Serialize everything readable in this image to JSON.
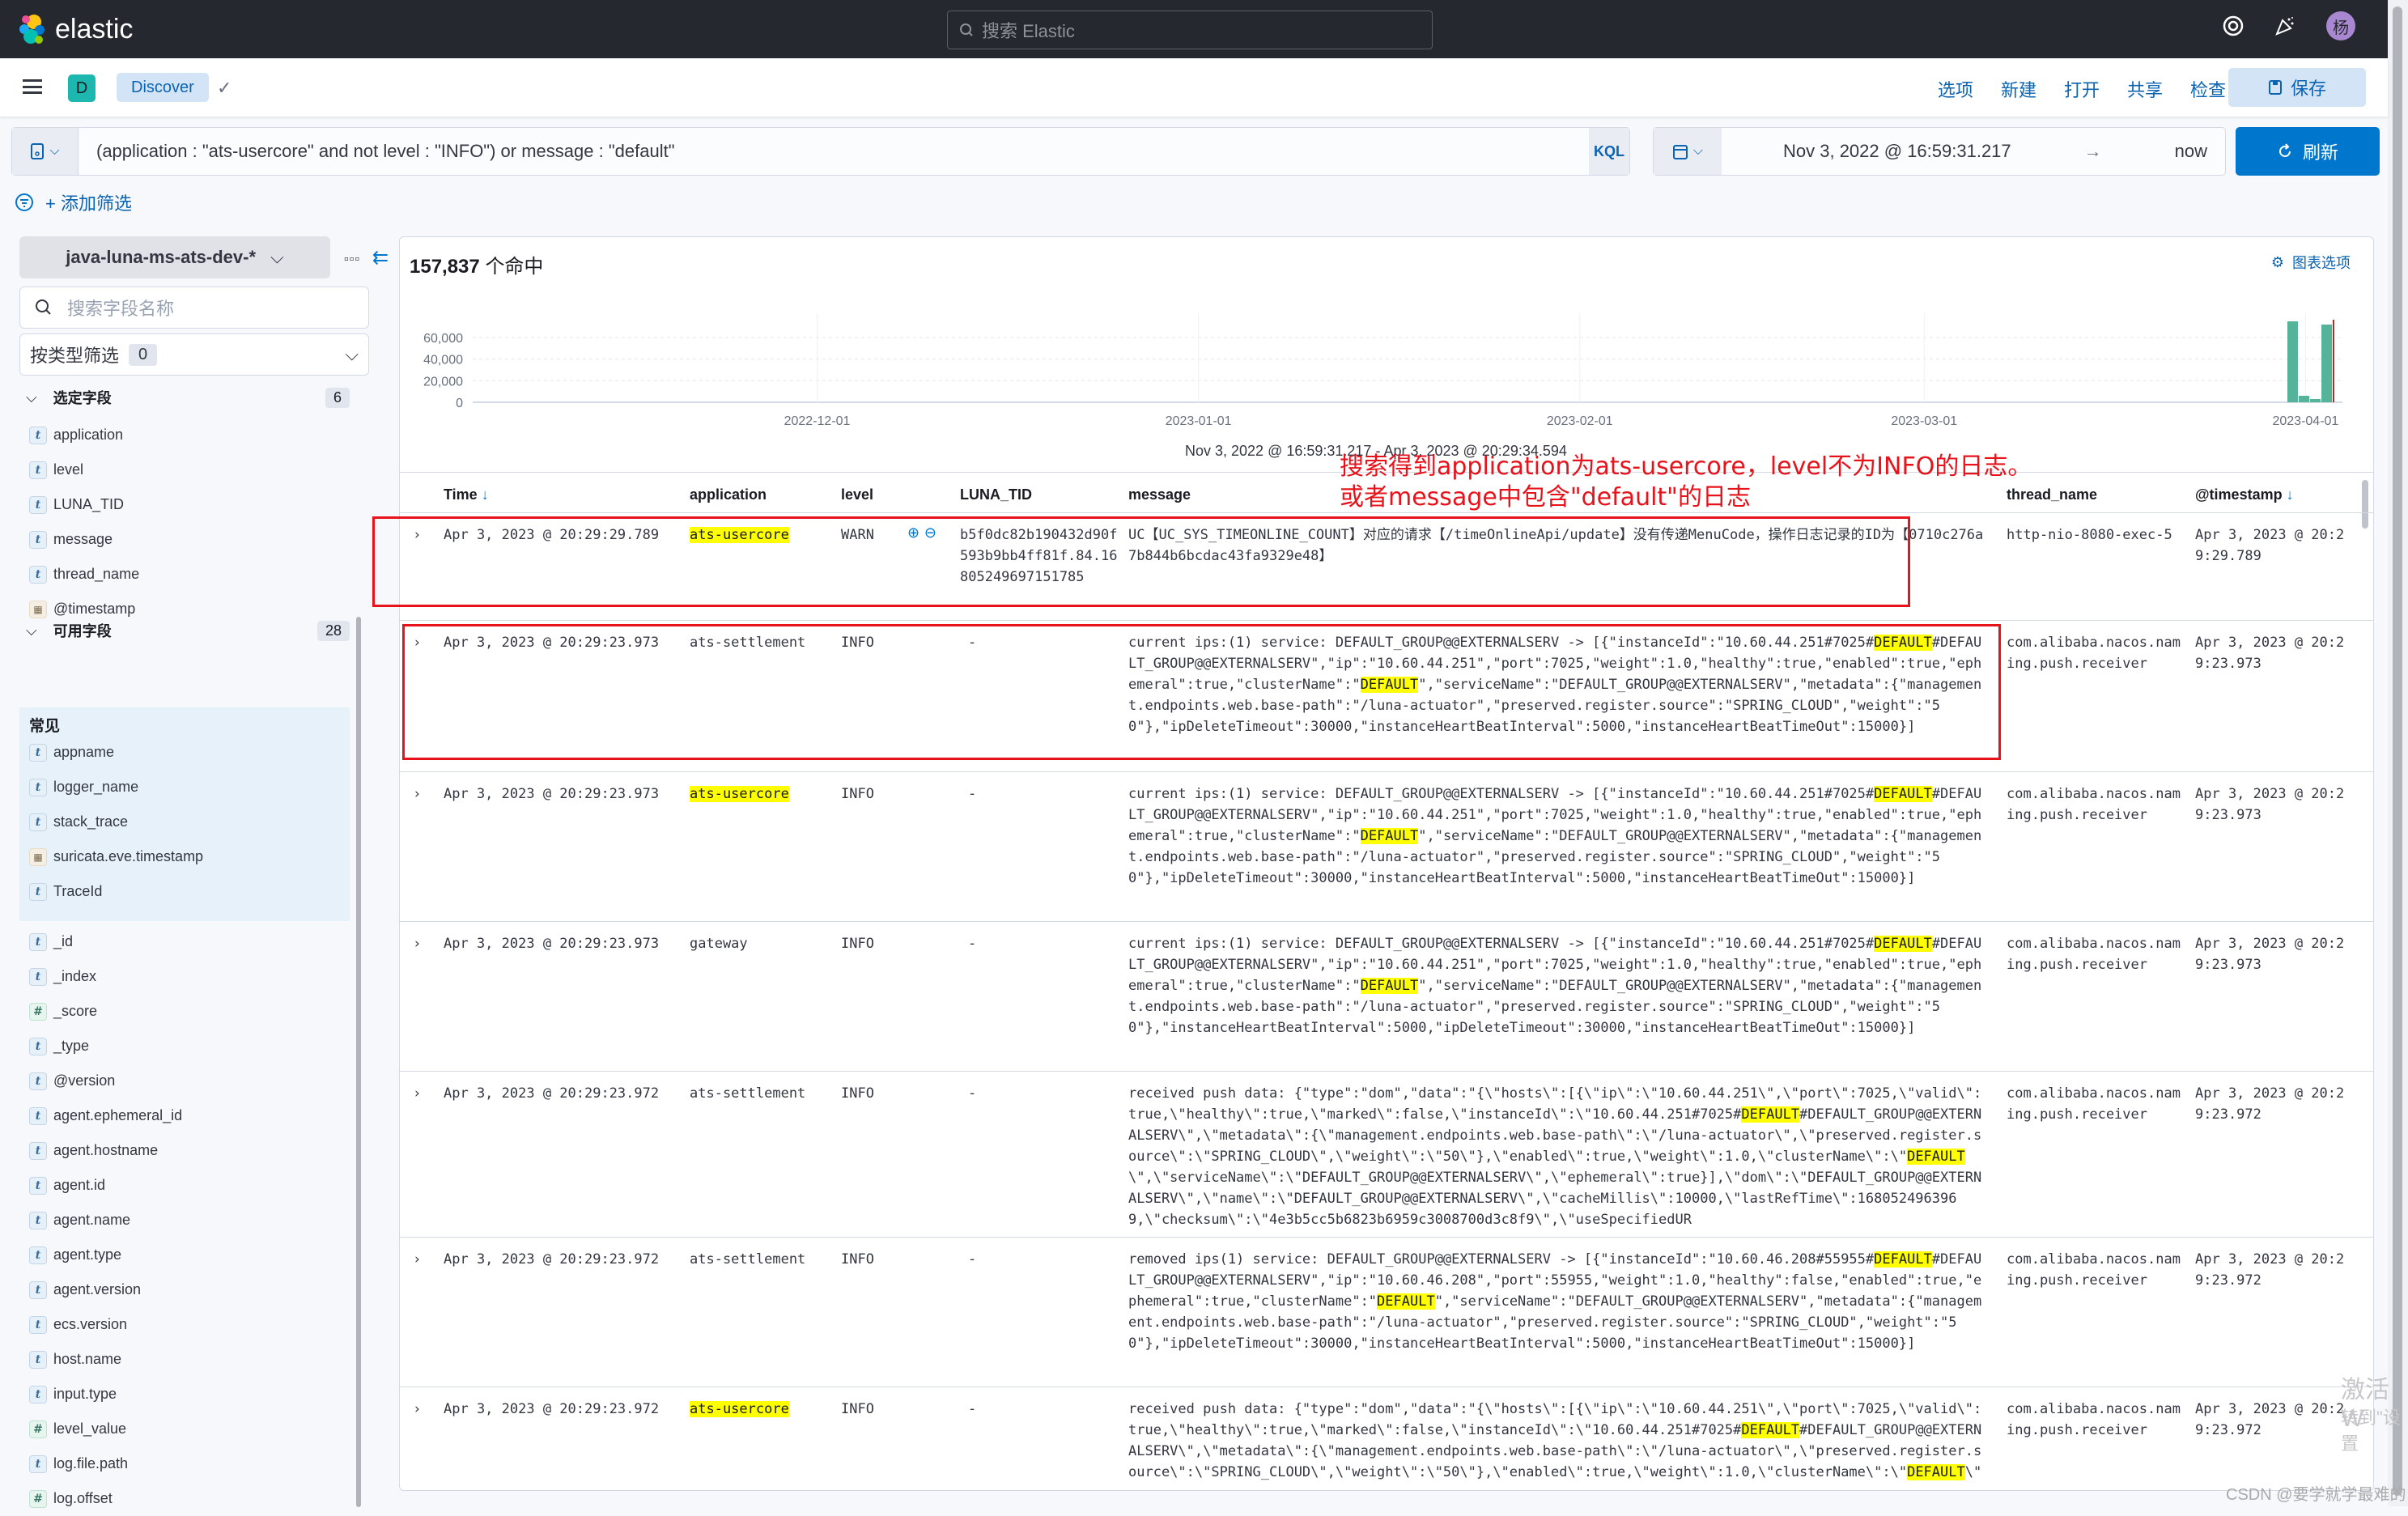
{
  "topbar": {
    "logo_text": "elastic",
    "search_placeholder": "搜索 Elastic",
    "avatar_initial": "杨"
  },
  "appbar": {
    "space_initial": "D",
    "breadcrumb": "Discover",
    "links": [
      "选项",
      "新建",
      "打开",
      "共享",
      "检查"
    ],
    "save_label": "保存"
  },
  "query": {
    "text": "(application : \"ats-usercore\" and not level : \"INFO\") or message : \"default\"",
    "language": "KQL",
    "date_start": "Nov 3, 2022 @ 16:59:31.217",
    "date_arrow": "→",
    "date_end": "now",
    "refresh_label": "刷新",
    "add_filter": "+ 添加筛选"
  },
  "sidebar": {
    "index_pattern": "java-luna-ms-ats-dev-*",
    "field_search_placeholder": "搜索字段名称",
    "type_filter_label": "按类型筛选",
    "type_filter_count": "0",
    "selected_title": "选定字段",
    "selected_count": "6",
    "selected_fields": [
      {
        "name": "application",
        "type": "t"
      },
      {
        "name": "level",
        "type": "t"
      },
      {
        "name": "LUNA_TID",
        "type": "t"
      },
      {
        "name": "message",
        "type": "t"
      },
      {
        "name": "thread_name",
        "type": "t"
      },
      {
        "name": "@timestamp",
        "type": "date"
      }
    ],
    "available_title": "可用字段",
    "available_count": "28",
    "common_title": "常见",
    "common_fields": [
      {
        "name": "appname",
        "type": "t"
      },
      {
        "name": "logger_name",
        "type": "t"
      },
      {
        "name": "stack_trace",
        "type": "t"
      },
      {
        "name": "suricata.eve.timestamp",
        "type": "date"
      },
      {
        "name": "TraceId",
        "type": "t"
      }
    ],
    "other_fields": [
      {
        "name": "_id",
        "type": "t"
      },
      {
        "name": "_index",
        "type": "t"
      },
      {
        "name": "_score",
        "type": "num"
      },
      {
        "name": "_type",
        "type": "t"
      },
      {
        "name": "@version",
        "type": "t"
      },
      {
        "name": "agent.ephemeral_id",
        "type": "t"
      },
      {
        "name": "agent.hostname",
        "type": "t"
      },
      {
        "name": "agent.id",
        "type": "t"
      },
      {
        "name": "agent.name",
        "type": "t"
      },
      {
        "name": "agent.type",
        "type": "t"
      },
      {
        "name": "agent.version",
        "type": "t"
      },
      {
        "name": "ecs.version",
        "type": "t"
      },
      {
        "name": "host.name",
        "type": "t"
      },
      {
        "name": "input.type",
        "type": "t"
      },
      {
        "name": "level_value",
        "type": "num"
      },
      {
        "name": "log.file.path",
        "type": "t"
      },
      {
        "name": "log.offset",
        "type": "num"
      }
    ]
  },
  "results": {
    "hit_count": "157,837",
    "hit_suffix": "个命中",
    "chart_options": "图表选项",
    "range_text": "Nov 3, 2022 @ 16:59:31.217 - Apr 3, 2023 @ 20:29:34.594"
  },
  "chart_data": {
    "type": "bar",
    "title": "",
    "xlabel": "",
    "ylabel": "",
    "ylim": [
      0,
      75000
    ],
    "y_ticks": [
      "0",
      "20,000",
      "40,000",
      "60,000"
    ],
    "x_ticks": [
      "2022-12-01",
      "2023-01-01",
      "2023-02-01",
      "2023-03-01",
      "2023-04-01"
    ],
    "x_range": [
      "2022-11-03",
      "2023-04-04"
    ],
    "grid": true,
    "legend": "none",
    "bar_color": "#54b399",
    "categories": [
      "2023-04-01",
      "2023-04-02",
      "2023-04-03a",
      "2023-04-03b"
    ],
    "values": [
      75000,
      6000,
      3000,
      72000
    ]
  },
  "annotation": {
    "line1": "搜索得到application为ats-usercore，level不为INFO的日志。",
    "line2": "或者message中包含\"default\"的日志"
  },
  "table": {
    "columns": [
      "Time",
      "application",
      "level",
      "LUNA_TID",
      "message",
      "thread_name",
      "@timestamp"
    ],
    "rows": [
      {
        "time": "Apr 3, 2023 @ 20:29:29.789",
        "application": "ats-usercore",
        "app_highlight": true,
        "level": "WARN",
        "luna_tid": "b5f0dc82b190432d90f593b9bb4ff81f.84.16805249697151785",
        "message": "UC【UC_SYS_TIMEONLINE_COUNT】对应的请求【/timeOnlineApi/update】没有传递MenuCode，操作日志记录的ID为【0710c276a7b844b6bcdac43fa9329e48】",
        "thread_name": "http-nio-8080-exec-5",
        "timestamp": "Apr 3, 2023 @ 20:29:29.789"
      },
      {
        "time": "Apr 3, 2023 @ 20:29:23.973",
        "application": "ats-settlement",
        "app_highlight": false,
        "level": "INFO",
        "luna_tid": "-",
        "message": "current ips:(1) service: DEFAULT_GROUP@@EXTERNALSERV -> [{\"instanceId\":\"10.60.44.251#7025#[[DEFAULT]]#DEFAULT_GROUP@@EXTERNALSERV\",\"ip\":\"10.60.44.251\",\"port\":7025,\"weight\":1.0,\"healthy\":true,\"enabled\":true,\"ephemeral\":true,\"clusterName\":\"[[DEFAULT]]\",\"serviceName\":\"DEFAULT_GROUP@@EXTERNALSERV\",\"metadata\":{\"management.endpoints.web.base-path\":\"/luna-actuator\",\"preserved.register.source\":\"SPRING_CLOUD\",\"weight\":\"50\"},\"ipDeleteTimeout\":30000,\"instanceHeartBeatInterval\":5000,\"instanceHeartBeatTimeOut\":15000}]",
        "thread_name": "com.alibaba.nacos.naming.push.receiver",
        "timestamp": "Apr 3, 2023 @ 20:29:23.973"
      },
      {
        "time": "Apr 3, 2023 @ 20:29:23.973",
        "application": "ats-usercore",
        "app_highlight": true,
        "level": "INFO",
        "luna_tid": "-",
        "message": "current ips:(1) service: DEFAULT_GROUP@@EXTERNALSERV -> [{\"instanceId\":\"10.60.44.251#7025#[[DEFAULT]]#DEFAULT_GROUP@@EXTERNALSERV\",\"ip\":\"10.60.44.251\",\"port\":7025,\"weight\":1.0,\"healthy\":true,\"enabled\":true,\"ephemeral\":true,\"clusterName\":\"[[DEFAULT]]\",\"serviceName\":\"DEFAULT_GROUP@@EXTERNALSERV\",\"metadata\":{\"management.endpoints.web.base-path\":\"/luna-actuator\",\"preserved.register.source\":\"SPRING_CLOUD\",\"weight\":\"50\"},\"ipDeleteTimeout\":30000,\"instanceHeartBeatInterval\":5000,\"instanceHeartBeatTimeOut\":15000}]",
        "thread_name": "com.alibaba.nacos.naming.push.receiver",
        "timestamp": "Apr 3, 2023 @ 20:29:23.973"
      },
      {
        "time": "Apr 3, 2023 @ 20:29:23.973",
        "application": "gateway",
        "app_highlight": false,
        "level": "INFO",
        "luna_tid": "-",
        "message": "current ips:(1) service: DEFAULT_GROUP@@EXTERNALSERV -> [{\"instanceId\":\"10.60.44.251#7025#[[DEFAULT]]#DEFAULT_GROUP@@EXTERNALSERV\",\"ip\":\"10.60.44.251\",\"port\":7025,\"weight\":1.0,\"healthy\":true,\"enabled\":true,\"ephemeral\":true,\"clusterName\":\"[[DEFAULT]]\",\"serviceName\":\"DEFAULT_GROUP@@EXTERNALSERV\",\"metadata\":{\"management.endpoints.web.base-path\":\"/luna-actuator\",\"preserved.register.source\":\"SPRING_CLOUD\",\"weight\":\"50\"},\"instanceHeartBeatInterval\":5000,\"ipDeleteTimeout\":30000,\"instanceHeartBeatTimeOut\":15000}]",
        "thread_name": "com.alibaba.nacos.naming.push.receiver",
        "timestamp": "Apr 3, 2023 @ 20:29:23.973"
      },
      {
        "time": "Apr 3, 2023 @ 20:29:23.972",
        "application": "ats-settlement",
        "app_highlight": false,
        "level": "INFO",
        "luna_tid": "-",
        "message": "received push data: {\"type\":\"dom\",\"data\":\"{\\\"hosts\\\":[{\\\"ip\\\":\\\"10.60.44.251\\\",\\\"port\\\":7025,\\\"valid\\\":true,\\\"healthy\\\":true,\\\"marked\\\":false,\\\"instanceId\\\":\\\"10.60.44.251#7025#[[DEFAULT]]#DEFAULT_GROUP@@EXTERNALSERV\\\",\\\"metadata\\\":{\\\"management.endpoints.web.base-path\\\":\\\"/luna-actuator\\\",\\\"preserved.register.source\\\":\\\"SPRING_CLOUD\\\",\\\"weight\\\":\\\"50\\\"},\\\"enabled\\\":true,\\\"weight\\\":1.0,\\\"clusterName\\\":\\\"[[DEFAULT]]\\\",\\\"serviceName\\\":\\\"DEFAULT_GROUP@@EXTERNALSERV\\\",\\\"ephemeral\\\":true}],\\\"dom\\\":\\\"DEFAULT_GROUP@@EXTERNALSERV\\\",\\\"name\\\":\\\"DEFAULT_GROUP@@EXTERNALSERV\\\",\\\"cacheMillis\\\":10000,\\\"lastRefTime\\\":1680524963969,\\\"checksum\\\":\\\"4e3b5cc5b6823b6959c3008700d3c8f9\\\",\\\"useSpecifiedUR",
        "thread_name": "com.alibaba.nacos.naming.push.receiver",
        "timestamp": "Apr 3, 2023 @ 20:29:23.972"
      },
      {
        "time": "Apr 3, 2023 @ 20:29:23.972",
        "application": "ats-settlement",
        "app_highlight": false,
        "level": "INFO",
        "luna_tid": "-",
        "message": "removed ips(1) service: DEFAULT_GROUP@@EXTERNALSERV -> [{\"instanceId\":\"10.60.46.208#55955#[[DEFAULT]]#DEFAULT_GROUP@@EXTERNALSERV\",\"ip\":\"10.60.46.208\",\"port\":55955,\"weight\":1.0,\"healthy\":false,\"enabled\":true,\"ephemeral\":true,\"clusterName\":\"[[DEFAULT]]\",\"serviceName\":\"DEFAULT_GROUP@@EXTERNALSERV\",\"metadata\":{\"management.endpoints.web.base-path\":\"/luna-actuator\",\"preserved.register.source\":\"SPRING_CLOUD\",\"weight\":\"50\"},\"ipDeleteTimeout\":30000,\"instanceHeartBeatInterval\":5000,\"instanceHeartBeatTimeOut\":15000}]",
        "thread_name": "com.alibaba.nacos.naming.push.receiver",
        "timestamp": "Apr 3, 2023 @ 20:29:23.972"
      },
      {
        "time": "Apr 3, 2023 @ 20:29:23.972",
        "application": "ats-usercore",
        "app_highlight": true,
        "level": "INFO",
        "luna_tid": "-",
        "message": "received push data: {\"type\":\"dom\",\"data\":\"{\\\"hosts\\\":[{\\\"ip\\\":\\\"10.60.44.251\\\",\\\"port\\\":7025,\\\"valid\\\":true,\\\"healthy\\\":true,\\\"marked\\\":false,\\\"instanceId\\\":\\\"10.60.44.251#7025#[[DEFAULT]]#DEFAULT_GROUP@@EXTERNALSERV\\\",\\\"metadata\\\":{\\\"management.endpoints.web.base-path\\\":\\\"/luna-actuator\\\",\\\"preserved.register.source\\\":\\\"SPRING_CLOUD\\\",\\\"weight\\\":\\\"50\\\"},\\\"enabled\\\":true,\\\"weight\\\":1.0,\\\"clusterName\\\":\\\"[[DEFAULT]]\\\"",
        "thread_name": "com.alibaba.nacos.naming.push.receiver",
        "timestamp": "Apr 3, 2023 @ 20:29:23.972"
      }
    ]
  },
  "watermarks": {
    "activate_line1": "激活 W",
    "activate_line2": "转到\"设置",
    "csdn": "CSDN @要学就学最难的"
  }
}
